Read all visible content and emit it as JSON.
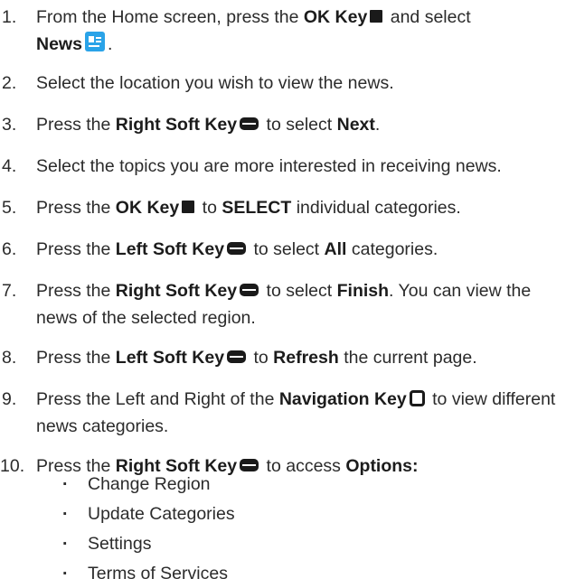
{
  "steps": [
    {
      "num": "1.",
      "parts": [
        "From the Home screen, press the ",
        "OK Key",
        " and select ",
        "News",
        "."
      ]
    },
    {
      "num": "2.",
      "parts": [
        "Select the location you wish to view the news."
      ]
    },
    {
      "num": "3.",
      "parts": [
        "Press the ",
        "Right Soft Key",
        " to select ",
        "Next",
        "."
      ]
    },
    {
      "num": "4.",
      "parts": [
        "Select the topics you are more interested in receiving news."
      ]
    },
    {
      "num": "5.",
      "parts": [
        "Press the ",
        "OK Key",
        " to ",
        "SELECT",
        " individual categories."
      ]
    },
    {
      "num": "6.",
      "parts": [
        "Press the ",
        "Left Soft Key",
        " to select ",
        "All",
        " categories."
      ]
    },
    {
      "num": "7.",
      "parts": [
        "Press the ",
        "Right Soft Key",
        " to select ",
        "Finish",
        ". You can view the news of the selected region."
      ]
    },
    {
      "num": "8.",
      "parts": [
        "Press the ",
        "Left Soft Key",
        " to ",
        "Refresh",
        " the current page."
      ]
    },
    {
      "num": "9.",
      "parts": [
        "Press the Left and Right of the ",
        "Navigation Key",
        " to view different news categories."
      ]
    },
    {
      "num": "10.",
      "parts": [
        "Press the ",
        "Right Soft Key",
        " to access ",
        "Options:"
      ]
    }
  ],
  "options": [
    "Change Region",
    "Update Categories",
    "Settings",
    "Terms of Services"
  ],
  "bullet": "·",
  "icons": {
    "ok_key": "ok-key-icon",
    "soft_key": "soft-key-icon",
    "navigation_key": "navigation-key-icon",
    "news_app": "news-app-icon"
  },
  "colors": {
    "text": "#2b2b2b",
    "icon": "#1a1a1a",
    "news_icon": "#2aa3e8"
  }
}
